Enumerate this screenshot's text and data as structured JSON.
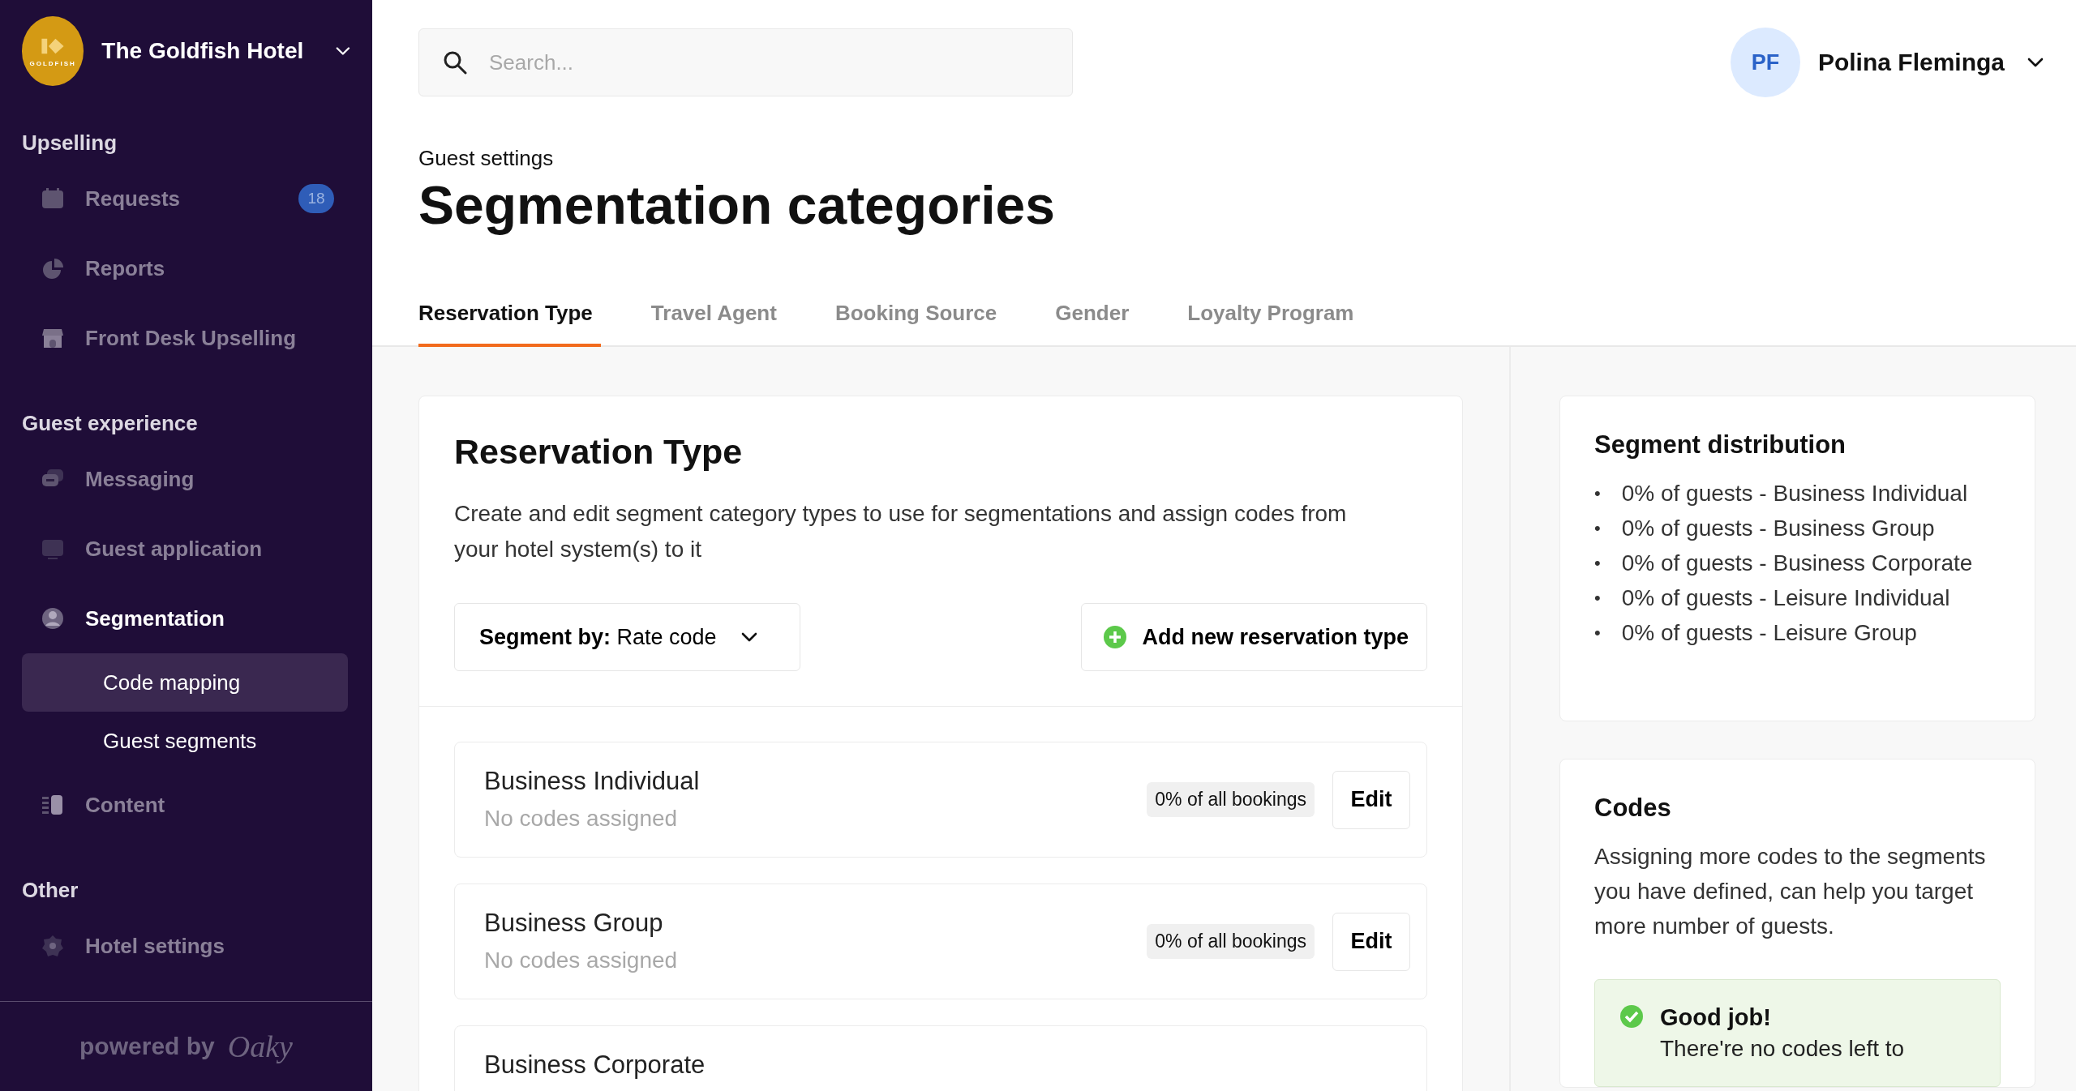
{
  "sidebar": {
    "logo_text": "GOLDFISH",
    "hotel_name": "The Goldfish Hotel",
    "sections": [
      {
        "title": "Upselling",
        "items": [
          {
            "label": "Requests",
            "badge": "18",
            "selected": false
          },
          {
            "label": "Reports",
            "selected": false
          },
          {
            "label": "Front Desk Upselling",
            "selected": false
          }
        ]
      },
      {
        "title": "Guest experience",
        "items": [
          {
            "label": "Messaging",
            "selected": false
          },
          {
            "label": "Guest application",
            "selected": false
          },
          {
            "label": "Segmentation",
            "selected": true,
            "expanded": true,
            "children": [
              {
                "label": "Code mapping",
                "selected": true
              },
              {
                "label": "Guest segments",
                "selected": false
              }
            ]
          },
          {
            "label": "Content",
            "selected": false
          }
        ]
      },
      {
        "title": "Other",
        "items": [
          {
            "label": "Hotel settings",
            "selected": false
          }
        ]
      }
    ],
    "footer": {
      "text": "powered by",
      "brand": "Oaky"
    }
  },
  "header": {
    "search": {
      "placeholder": "Search..."
    },
    "user": {
      "initials": "PF",
      "name": "Polina Fleminga"
    }
  },
  "page": {
    "breadcrumb": "Guest settings",
    "title": "Segmentation categories",
    "tabs": [
      {
        "label": "Reservation Type",
        "selected": true
      },
      {
        "label": "Travel Agent",
        "selected": false
      },
      {
        "label": "Booking Source",
        "selected": false
      },
      {
        "label": "Gender",
        "selected": false
      },
      {
        "label": "Loyalty Program",
        "selected": false
      }
    ]
  },
  "card": {
    "title": "Reservation Type",
    "description": "Create and edit segment category types to use for segmentations and assign codes from your hotel system(s) to it",
    "segment_by": {
      "label": "Segment by:",
      "value": "Rate code"
    },
    "add_button": "Add new reservation type",
    "rows": [
      {
        "name": "Business Individual",
        "codes": "No codes assigned",
        "share": "0% of all bookings",
        "action": "Edit"
      },
      {
        "name": "Business Group",
        "codes": "No codes assigned",
        "share": "0% of all bookings",
        "action": "Edit"
      },
      {
        "name": "Business Corporate"
      }
    ]
  },
  "distribution": {
    "title": "Segment distribution",
    "items": [
      {
        "marker": "•",
        "text": "0% of guests - Business Individual"
      },
      {
        "marker": "•",
        "text": "0% of guests - Business Group"
      },
      {
        "marker": "•",
        "text": "0% of guests - Business Corporate"
      },
      {
        "marker": "•",
        "text": "0% of guests - Leisure Individual"
      },
      {
        "marker": "•",
        "text": "0% of guests - Leisure Group"
      }
    ]
  },
  "codes": {
    "title": "Codes",
    "text": "Assigning more codes to the segments you have defined, can help you target more number of guests.",
    "notice": {
      "title": "Good job!",
      "text": "There're no codes left to"
    }
  }
}
